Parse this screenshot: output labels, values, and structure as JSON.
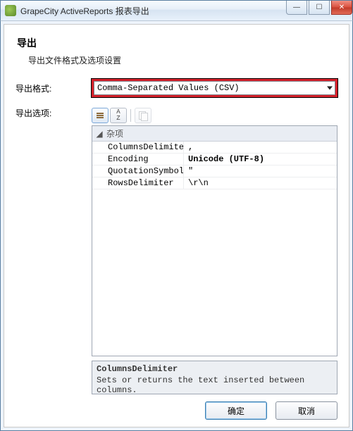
{
  "window": {
    "title": "GrapeCity ActiveReports 报表导出"
  },
  "header": {
    "title": "导出",
    "subtitle": "导出文件格式及选项设置"
  },
  "form": {
    "format_label": "导出格式:",
    "format_value": "Comma-Separated Values (CSV)",
    "options_label": "导出选项:"
  },
  "propgrid": {
    "category": "杂项",
    "rows": [
      {
        "name": "ColumnsDelimiter",
        "value": ",",
        "bold": false
      },
      {
        "name": "Encoding",
        "value": "Unicode (UTF-8)",
        "bold": true
      },
      {
        "name": "QuotationSymbol",
        "value": "\"",
        "bold": false
      },
      {
        "name": "RowsDelimiter",
        "value": "\\r\\n",
        "bold": false
      }
    ],
    "desc_name": "ColumnsDelimiter",
    "desc_text": "Sets or returns the text inserted between columns."
  },
  "buttons": {
    "ok": "确定",
    "cancel": "取消"
  }
}
